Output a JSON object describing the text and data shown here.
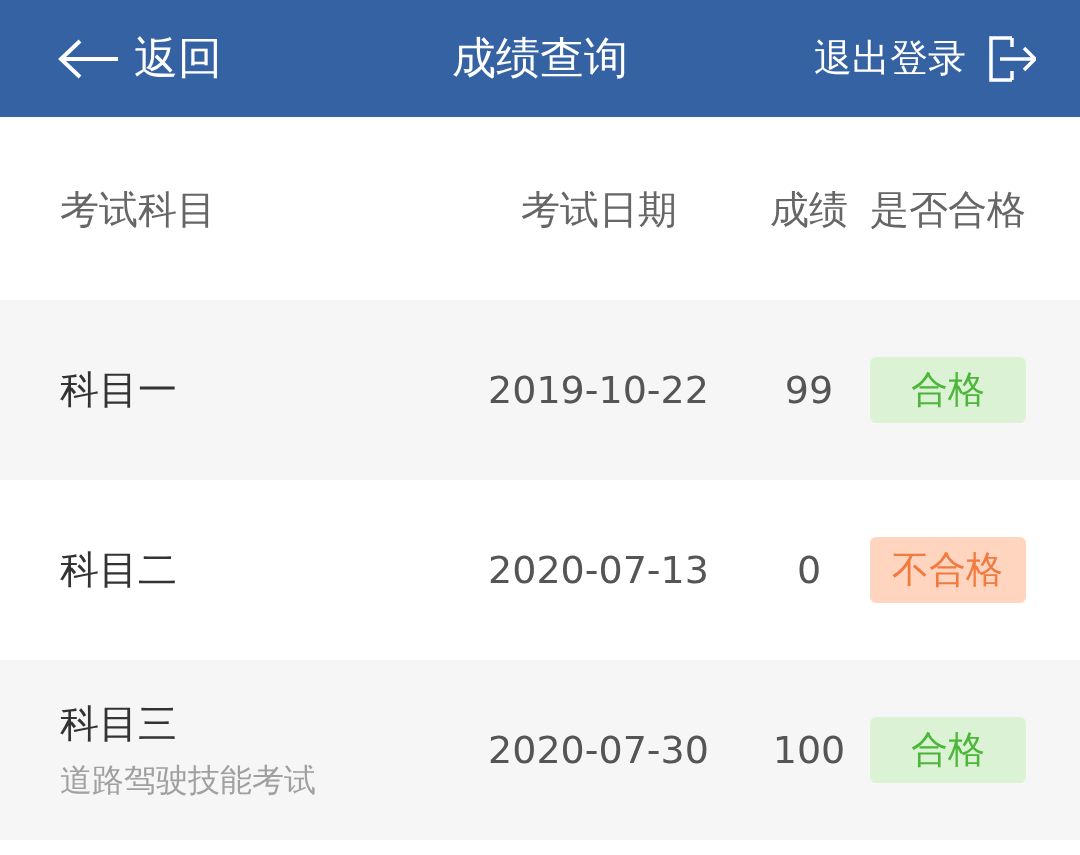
{
  "header": {
    "back": "返回",
    "title": "成绩查询",
    "logout": "退出登录"
  },
  "table": {
    "columns": [
      "考试科目",
      "考试日期",
      "成绩",
      "是否合格"
    ],
    "rows": [
      {
        "subject": "科目一",
        "date": "2019-10-22",
        "score": "99",
        "result": "合格",
        "passed": true
      },
      {
        "subject": "科目二",
        "date": "2020-07-13",
        "score": "0",
        "result": "不合格",
        "passed": false
      },
      {
        "subject": "科目三",
        "subtitle": "道路驾驶技能考试",
        "date": "2020-07-30",
        "score": "100",
        "result": "合格",
        "passed": true
      }
    ]
  }
}
